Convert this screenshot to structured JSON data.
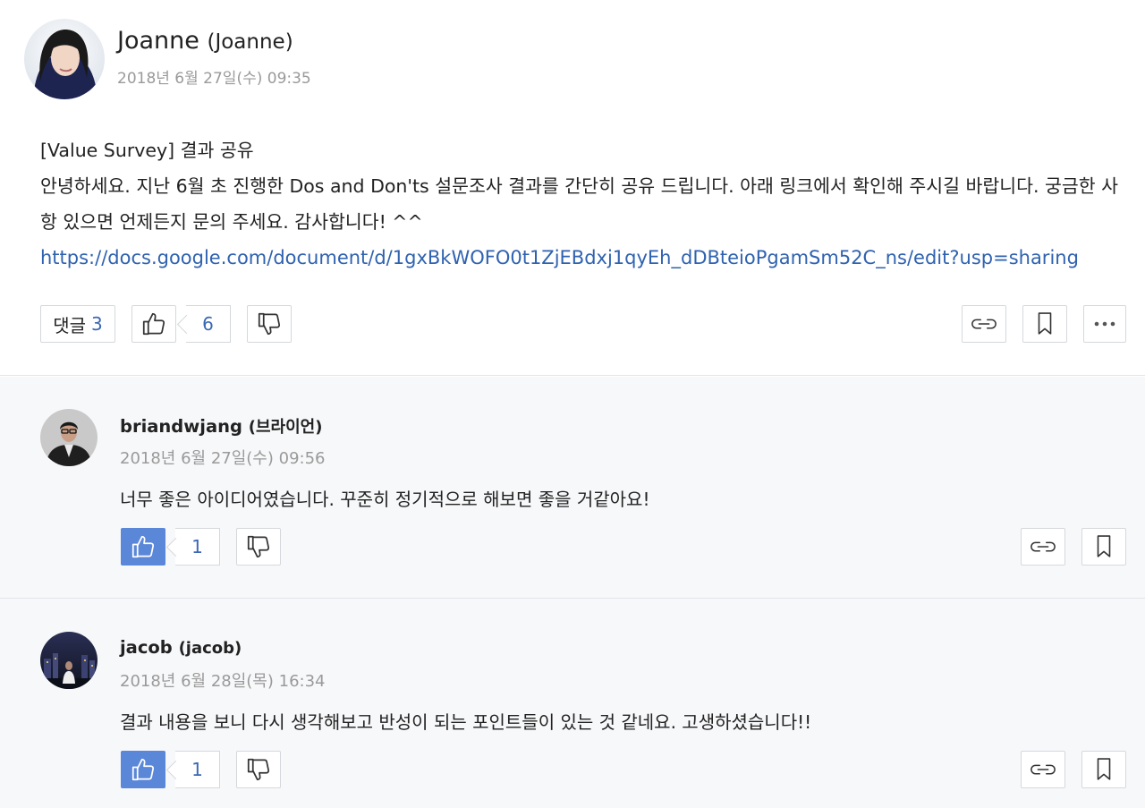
{
  "post": {
    "author_name": "Joanne",
    "author_alias": "(Joanne)",
    "date": "2018년 6월 27일(수) 09:35",
    "title_line": "[Value Survey] 결과 공유",
    "body_text": "안녕하세요. 지난 6월 초 진행한 Dos and Don'ts 설문조사 결과를 간단히 공유 드립니다. 아래 링크에서 확인해 주시길 바랍니다. 궁금한 사항 있으면 언제든지 문의 주세요. 감사합니다! ^^",
    "link": "https://docs.google.com/document/d/1gxBkWOFO0t1ZjEBdxj1qyEh_dDBteioPgamSm52C_ns/edit?usp=sharing",
    "comment_label": "댓글",
    "comment_count": "3",
    "like_count": "6"
  },
  "comments": [
    {
      "author_name": "briandwjang",
      "author_alias": "(브라이언)",
      "date": "2018년 6월 27일(수) 09:56",
      "text": "너무 좋은 아이디어였습니다. 꾸준히 정기적으로 해보면 좋을 거같아요!",
      "like_count": "1",
      "liked": true
    },
    {
      "author_name": "jacob",
      "author_alias": "(jacob)",
      "date": "2018년 6월 28일(목) 16:34",
      "text": "결과 내용을 보니 다시 생각해보고 반성이 되는 포인트들이 있는 것 같네요. 고생하셨습니다!!",
      "like_count": "1",
      "liked": true
    }
  ],
  "icons": {
    "like": "thumbs-up-icon",
    "dislike": "thumbs-down-icon",
    "link": "link-icon",
    "bookmark": "bookmark-icon",
    "more": "more-icon"
  },
  "colors": {
    "accent": "#3b67b5",
    "liked_bg": "#5b87d8",
    "link": "#2f62b0",
    "muted": "#9a9a9a"
  }
}
